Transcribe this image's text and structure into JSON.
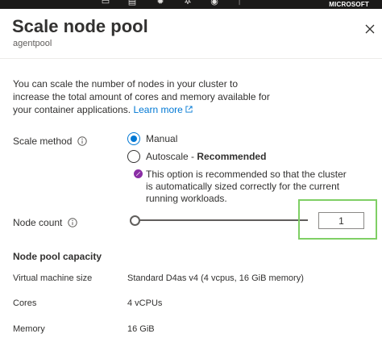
{
  "topbar": {
    "brand": "MICROSOFT",
    "icons": [
      "terminal-icon",
      "filter-icon",
      "bell-icon",
      "gear-icon",
      "help-icon",
      "feedback-icon"
    ]
  },
  "panel": {
    "title": "Scale node pool",
    "subtitle": "agentpool",
    "description": "You can scale the number of nodes in your cluster to increase the total amount of cores and memory available for your container applications.",
    "learn_more": "Learn more"
  },
  "scale_method": {
    "label": "Scale method",
    "options": [
      {
        "label": "Manual",
        "suffix": "",
        "selected": true
      },
      {
        "label": "Autoscale",
        "suffix": "Recommended",
        "selected": false
      }
    ],
    "separator": " - ",
    "note": "This option is recommended so that the cluster is automatically sized correctly for the current running workloads."
  },
  "node_count": {
    "label": "Node count",
    "value": "1",
    "slider_level": 0
  },
  "capacity": {
    "title": "Node pool capacity",
    "rows": [
      {
        "label": "Virtual machine size",
        "value": "Standard D4as v4 (4 vcpus, 16 GiB memory)"
      },
      {
        "label": "Cores",
        "value": "4 vCPUs"
      },
      {
        "label": "Memory",
        "value": "16 GiB"
      }
    ]
  },
  "colors": {
    "accent": "#0078d4",
    "highlight": "#7fcf65",
    "note_icon": "#8a2da5",
    "topbar": "#1b1a19"
  }
}
